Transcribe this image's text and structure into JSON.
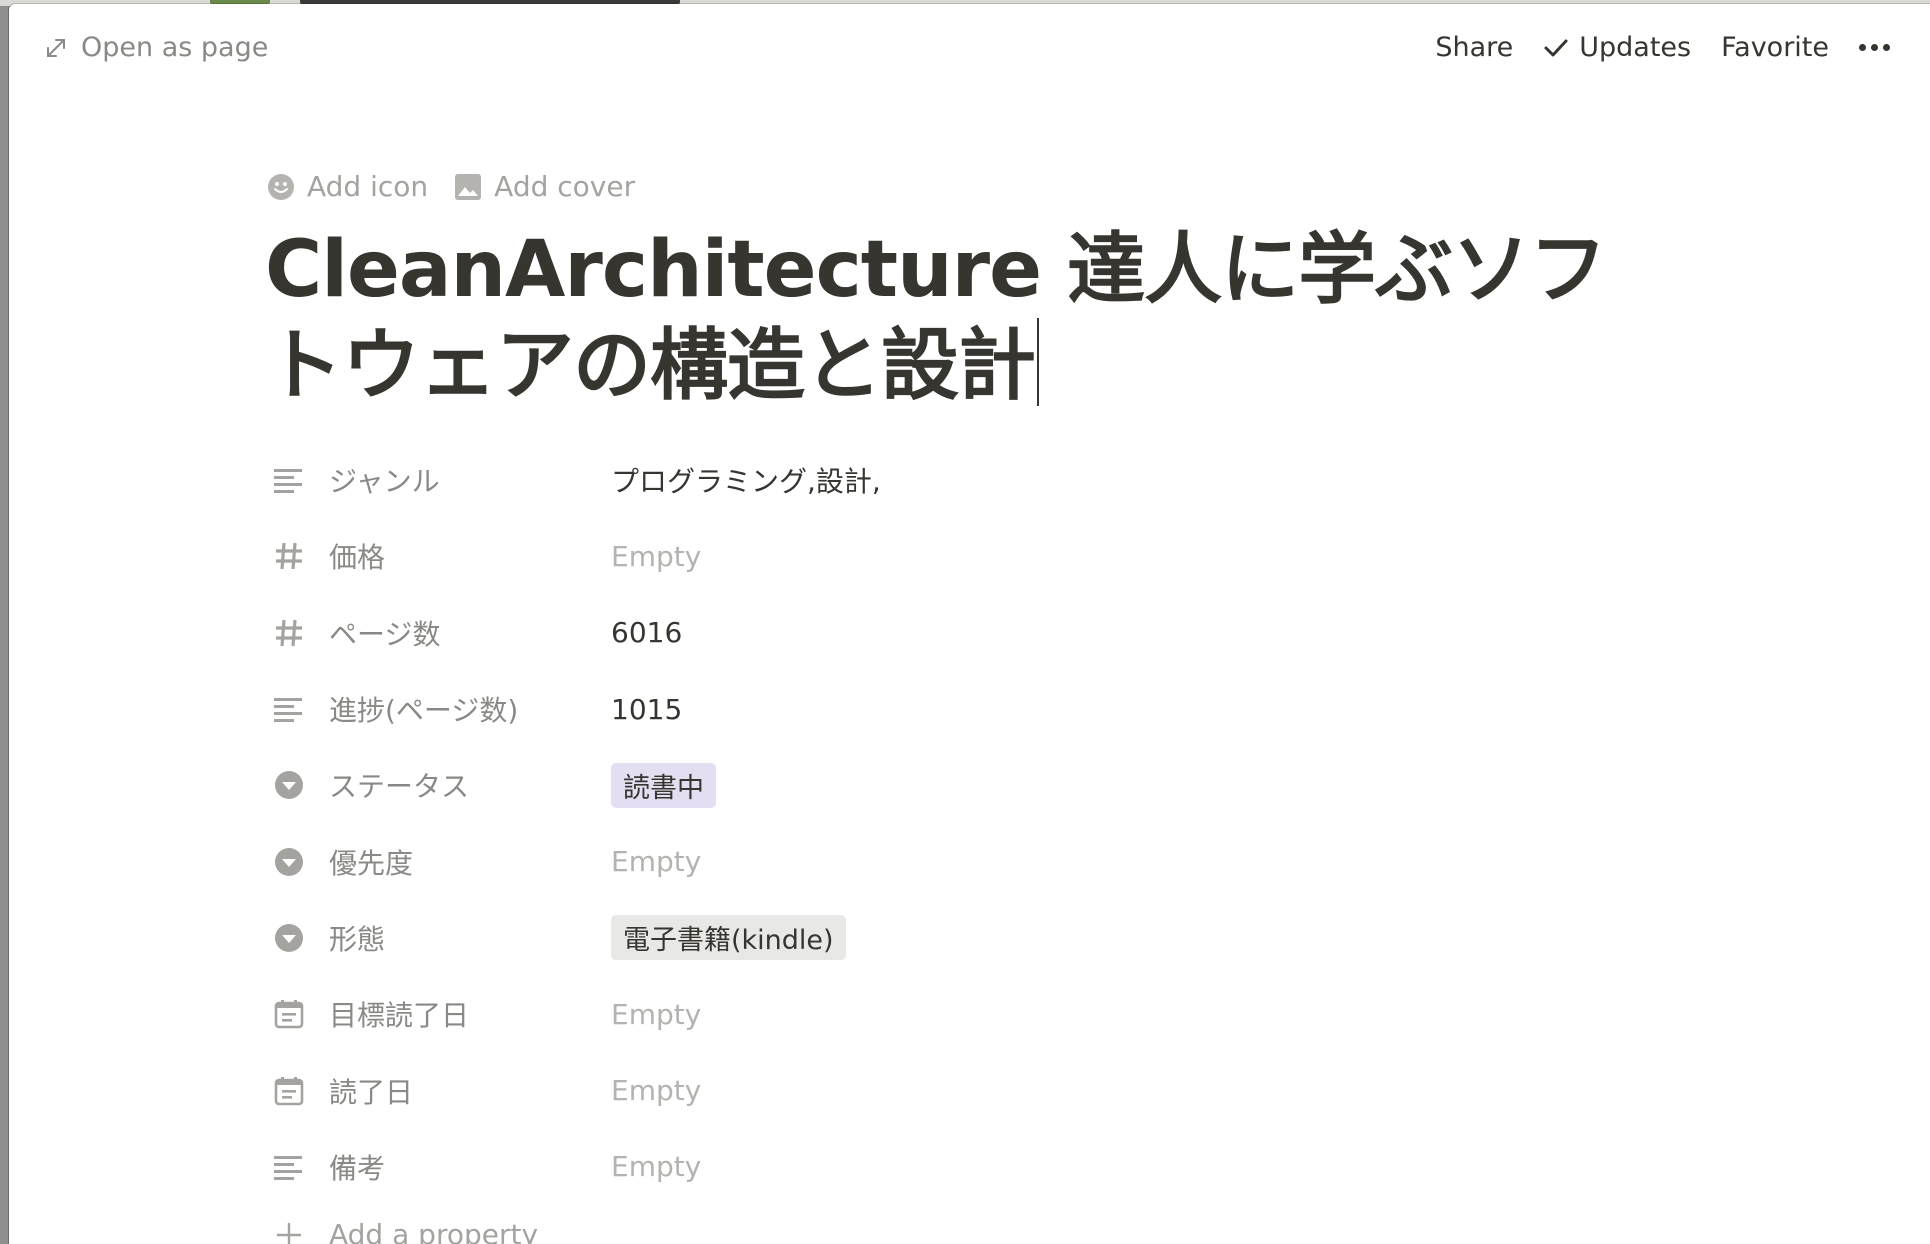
{
  "topbar": {
    "open_as_page": "Open as page",
    "share": "Share",
    "updates": "Updates",
    "favorite": "Favorite"
  },
  "header": {
    "add_icon": "Add icon",
    "add_cover": "Add cover",
    "title": "CleanArchitecture 達人に学ぶソフトウェアの構造と設計"
  },
  "properties": [
    {
      "name": "ジャンル",
      "icon": "text-icon",
      "value": "プログラミング,設計,",
      "empty": false
    },
    {
      "name": "価格",
      "icon": "number-icon",
      "value": "Empty",
      "empty": true
    },
    {
      "name": "ページ数",
      "icon": "number-icon",
      "value": "6016",
      "empty": false
    },
    {
      "name": "進捗(ページ数)",
      "icon": "text-icon",
      "value": "1015",
      "empty": false
    },
    {
      "name": "ステータス",
      "icon": "select-icon",
      "value": "読書中",
      "tag_color": "#e3def1"
    },
    {
      "name": "優先度",
      "icon": "select-icon",
      "value": "Empty",
      "empty": true
    },
    {
      "name": "形態",
      "icon": "select-icon",
      "value": "電子書籍(kindle)",
      "tag_color": "#e8e8e6"
    },
    {
      "name": "目標読了日",
      "icon": "calendar-icon",
      "value": "Empty",
      "empty": true
    },
    {
      "name": "読了日",
      "icon": "calendar-icon",
      "value": "Empty",
      "empty": true
    },
    {
      "name": "備考",
      "icon": "text-icon",
      "value": "Empty",
      "empty": true
    }
  ],
  "add_property": "Add a property"
}
